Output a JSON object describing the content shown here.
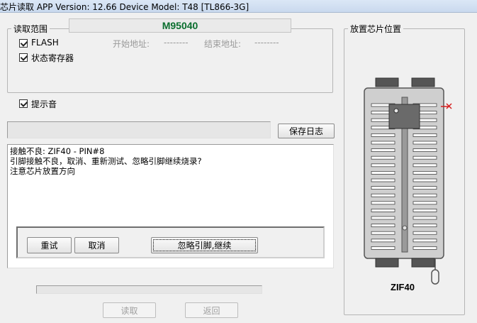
{
  "window": {
    "title": "芯片读取    APP Version: 12.66 Device Model: T48 [TL866-3G]"
  },
  "read_range": {
    "legend": "读取范围",
    "chip_name": "M95040",
    "flash_label": "FLASH",
    "status_reg_label": "状态寄存器",
    "start_addr_label": "开始地址:",
    "start_addr_value": "--------",
    "end_addr_label": "结束地址:",
    "end_addr_value": "--------"
  },
  "prompt_sound_label": "提示音",
  "save_log_label": "保存日志",
  "log_lines": [
    "接触不良: ZIF40 - PIN#8",
    "引脚接触不良，取消、重新测试、忽略引脚继续烧录?",
    "注意芯片放置方向"
  ],
  "dialog_buttons": {
    "retry": "重试",
    "cancel": "取消",
    "ignore": "忽略引脚,继续"
  },
  "footer": {
    "read": "读取",
    "back": "返回"
  },
  "placement": {
    "legend": "放置芯片位置",
    "socket_label": "ZIF40"
  },
  "colors": {
    "accent_text": "#0a6e2e",
    "error_marker": "#d62020"
  }
}
